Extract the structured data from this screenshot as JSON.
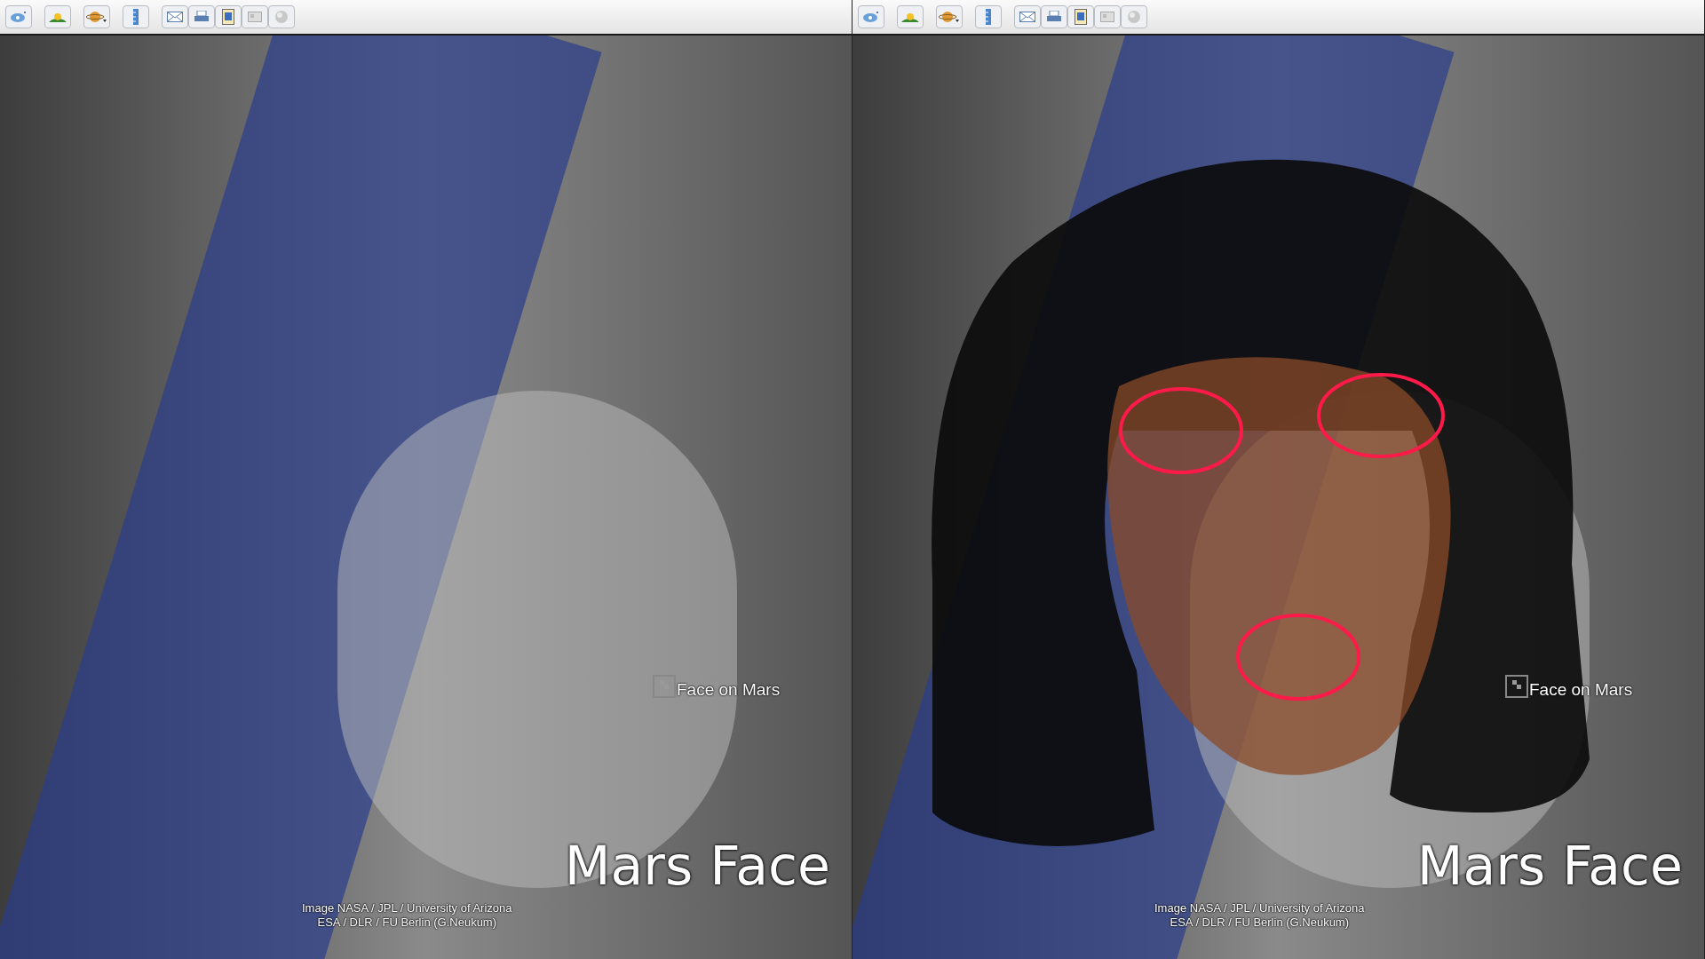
{
  "panels": [
    {
      "kind": "plain",
      "placemark": "Face on Mars",
      "title": "Mars Face",
      "attribution": [
        "Image NASA / JPL / University of Arizona",
        "ESA / DLR / FU Berlin (G.Neukum)"
      ]
    },
    {
      "kind": "face-overlay",
      "placemark": "Face on Mars",
      "title": "Mars Face",
      "attribution": [
        "Image NASA / JPL / University of Arizona",
        "ESA / DLR / FU Berlin (G.Neukum)"
      ]
    }
  ]
}
